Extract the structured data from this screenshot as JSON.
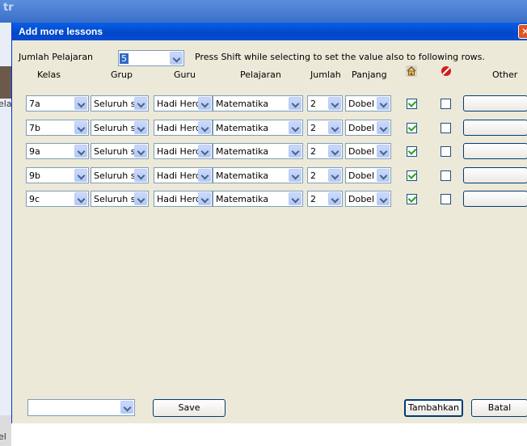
{
  "dialog": {
    "title": "Add more lessons",
    "close_glyph": "✕",
    "count_label": "Jumlah Pelajaran",
    "count_value": "5",
    "hint": "Press Shift while selecting to set the value also to following rows."
  },
  "headers": {
    "kelas": "Kelas",
    "grup": "Grup",
    "guru": "Guru",
    "pelajaran": "Pelajaran",
    "jumlah": "Jumlah",
    "panjang": "Panjang",
    "home_icon": "home-icon",
    "stop_icon": "stop-icon",
    "other": "Other"
  },
  "rows": [
    {
      "kelas": "7a",
      "grup": "Seluruh si",
      "guru": "Hadi Herdi",
      "pelajaran": "Matematika",
      "jumlah": "2",
      "panjang": "Dobel",
      "home": true,
      "stop": false
    },
    {
      "kelas": "7b",
      "grup": "Seluruh si",
      "guru": "Hadi Herdi",
      "pelajaran": "Matematika",
      "jumlah": "2",
      "panjang": "Dobel",
      "home": true,
      "stop": false
    },
    {
      "kelas": "9a",
      "grup": "Seluruh si",
      "guru": "Hadi Herdi",
      "pelajaran": "Matematika",
      "jumlah": "2",
      "panjang": "Dobel",
      "home": true,
      "stop": false
    },
    {
      "kelas": "9b",
      "grup": "Seluruh si",
      "guru": "Hadi Herdi",
      "pelajaran": "Matematika",
      "jumlah": "2",
      "panjang": "Dobel",
      "home": true,
      "stop": false
    },
    {
      "kelas": "9c",
      "grup": "Seluruh si",
      "guru": "Hadi Herdi",
      "pelajaran": "Matematika",
      "jumlah": "2",
      "panjang": "Dobel",
      "home": true,
      "stop": false
    }
  ],
  "footer": {
    "preset_value": "",
    "save": "Save",
    "add": "Tambahkan",
    "cancel": "Batal"
  },
  "background": {
    "left_text_top": "ela",
    "left_text_bottom": "el"
  },
  "colors": {
    "titlebar": "#0a5fe6",
    "dialog_bg": "#ece9d8",
    "close": "#e0531f",
    "check": "#21a121"
  }
}
